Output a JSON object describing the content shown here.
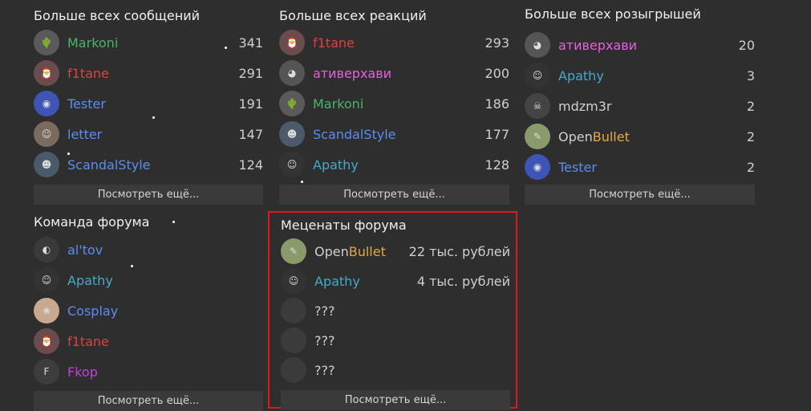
{
  "colors": {
    "background": "#2e2e2e",
    "button_bg": "#3a3a3a",
    "highlight_border": "#e01818",
    "green": "#4bb36a",
    "red": "#e04040",
    "blue": "#5b8df0",
    "pink": "#e65fe0",
    "teal": "#45a9c9",
    "gray": "#d0d0d0",
    "purple": "#c040d8",
    "gold": "#e3a84a"
  },
  "messages": {
    "title": "Больше всех сообщений",
    "more": "Посмотреть ещё...",
    "rows": [
      {
        "name": "Markoni",
        "value": "341",
        "color": "green",
        "avatar": "cactus-avatar-icon",
        "glyph": "🌵",
        "bg": "#5a5a5a"
      },
      {
        "name": "f1tane",
        "value": "291",
        "color": "red",
        "avatar": "santa-avatar-icon",
        "glyph": "🎅",
        "bg": "#6b4c4c"
      },
      {
        "name": "Tester",
        "value": "191",
        "color": "blue",
        "avatar": "tester-avatar-icon",
        "glyph": "◉",
        "bg": "#3f55b5"
      },
      {
        "name": "letter",
        "value": "147",
        "color": "blue",
        "avatar": "anime-avatar-icon",
        "glyph": "☺",
        "bg": "#7a6a60"
      },
      {
        "name": "ScandalStyle",
        "value": "124",
        "color": "blue",
        "avatar": "person-avatar-icon",
        "glyph": "☻",
        "bg": "#4a5a6a"
      }
    ]
  },
  "reactions": {
    "title": "Больше всех реакций",
    "more": "Посмотреть ещё...",
    "rows": [
      {
        "name": "f1tane",
        "value": "293",
        "color": "red",
        "avatar": "santa-avatar-icon",
        "glyph": "🎅",
        "bg": "#6b4c4c"
      },
      {
        "name": "ативерхави",
        "value": "200",
        "color": "pink",
        "avatar": "bird-avatar-icon",
        "glyph": "◕",
        "bg": "#555"
      },
      {
        "name": "Markoni",
        "value": "186",
        "color": "green",
        "avatar": "cactus-avatar-icon",
        "glyph": "🌵",
        "bg": "#5a5a5a"
      },
      {
        "name": "ScandalStyle",
        "value": "177",
        "color": "blue",
        "avatar": "person-avatar-icon",
        "glyph": "☻",
        "bg": "#4a5a6a"
      },
      {
        "name": "Apathy",
        "value": "128",
        "color": "teal",
        "avatar": "anime-avatar-icon",
        "glyph": "☺",
        "bg": "#333"
      }
    ]
  },
  "giveaways": {
    "title": "Больше всех розыгрышей",
    "more": "Посмотреть ещё...",
    "rows": [
      {
        "name": "ативерхави",
        "value": "20",
        "color": "pink",
        "avatar": "bird-avatar-icon",
        "glyph": "◕",
        "bg": "#555"
      },
      {
        "name": "Apathy",
        "value": "3",
        "color": "teal",
        "avatar": "anime-avatar-icon",
        "glyph": "☺",
        "bg": "#333"
      },
      {
        "name": "mdzm3r",
        "value": "2",
        "color": "gray",
        "avatar": "mask-avatar-icon",
        "glyph": "☠",
        "bg": "#444"
      },
      {
        "name_a": "Open",
        "name_b": "Bullet",
        "value": "2",
        "color": "gray",
        "avatar": "openbullet-avatar-icon",
        "glyph": "✎",
        "bg": "#8a9a6a"
      },
      {
        "name": "Tester",
        "value": "2",
        "color": "blue",
        "avatar": "tester-avatar-icon",
        "glyph": "◉",
        "bg": "#3f55b5"
      }
    ]
  },
  "team": {
    "title": "Команда форума",
    "more": "Посмотреть ещё...",
    "rows": [
      {
        "name": "al'tov",
        "value": "",
        "color": "blue",
        "avatar": "dark-avatar-icon",
        "glyph": "◐",
        "bg": "#3a3a3a"
      },
      {
        "name": "Apathy",
        "value": "",
        "color": "teal",
        "avatar": "anime-avatar-icon",
        "glyph": "☺",
        "bg": "#333"
      },
      {
        "name": "Cosplay",
        "value": "",
        "color": "blue",
        "avatar": "cosplay-avatar-icon",
        "glyph": "❀",
        "bg": "#c9a890"
      },
      {
        "name": "f1tane",
        "value": "",
        "color": "red",
        "avatar": "santa-avatar-icon",
        "glyph": "🎅",
        "bg": "#6b4c4c"
      },
      {
        "name": "Fkop",
        "value": "",
        "color": "purple",
        "avatar": "letter-avatar-icon",
        "glyph": "F",
        "bg": "#3d3d3d"
      }
    ]
  },
  "patrons": {
    "title": "Меценаты форума",
    "more": "Посмотреть ещё...",
    "rows": [
      {
        "name_a": "Open",
        "name_b": "Bullet",
        "value": "22 тыс. рублей",
        "color": "gray",
        "avatar": "openbullet-avatar-icon",
        "glyph": "✎",
        "bg": "#8a9a6a"
      },
      {
        "name": "Apathy",
        "value": "4 тыс. рублей",
        "color": "teal",
        "avatar": "anime-avatar-icon",
        "glyph": "☺",
        "bg": "#333"
      },
      {
        "name": "???",
        "value": "",
        "color": "gray",
        "avatar": "empty-avatar-icon",
        "glyph": "",
        "bg": "#3b3b3b"
      },
      {
        "name": "???",
        "value": "",
        "color": "gray",
        "avatar": "empty-avatar-icon",
        "glyph": "",
        "bg": "#3b3b3b"
      },
      {
        "name": "???",
        "value": "",
        "color": "gray",
        "avatar": "empty-avatar-icon",
        "glyph": "",
        "bg": "#3b3b3b"
      }
    ]
  }
}
